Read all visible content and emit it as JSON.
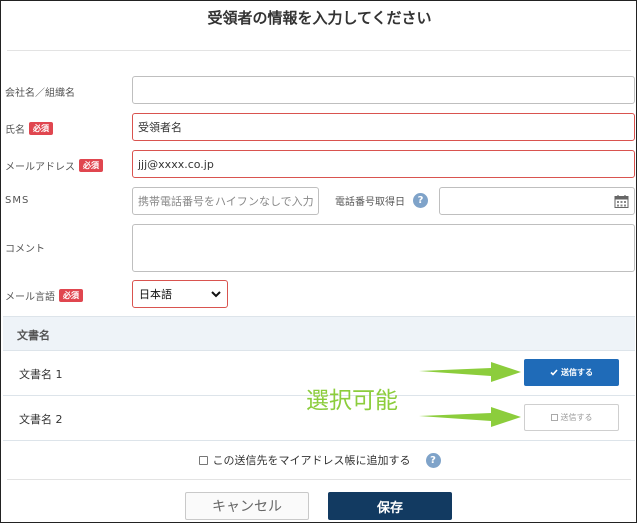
{
  "title": "受領者の情報を入力してください",
  "required_badge": "必須",
  "form": {
    "company": {
      "label": "会社名／組織名",
      "value": ""
    },
    "name": {
      "label": "氏名",
      "value": "受領者名"
    },
    "email": {
      "label": "メールアドレス",
      "value": "jjj@xxxx.co.jp"
    },
    "sms": {
      "label": "SMS",
      "placeholder": "携帯電話番号をハイフンなしで入力く"
    },
    "phone_date": {
      "label": "電話番号取得日",
      "value": ""
    },
    "comment": {
      "label": "コメント",
      "value": ""
    },
    "mail_language": {
      "label": "メール言語",
      "selected": "日本語"
    }
  },
  "documents": {
    "header": "文書名",
    "rows": [
      {
        "name": "文書名 1",
        "button": "送信する",
        "selected": true
      },
      {
        "name": "文書名 2",
        "button": "送信する",
        "selected": false
      }
    ]
  },
  "annotation": {
    "text": "選択可能",
    "color": "#8ccd3c"
  },
  "address_book": {
    "label": "この送信先をマイアドレス帳に追加する",
    "checked": false
  },
  "buttons": {
    "cancel": "キャンセル",
    "save": "保存"
  },
  "colors": {
    "required": "#e0464f",
    "primary": "#1f6bb8",
    "save": "#123a61",
    "help": "#7fa3c9"
  }
}
